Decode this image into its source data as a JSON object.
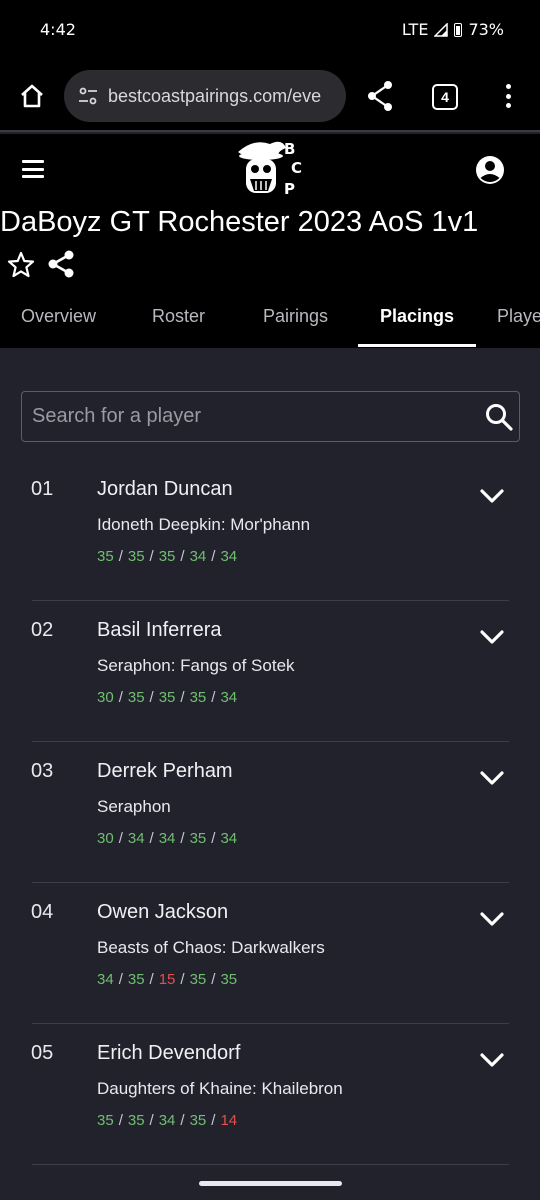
{
  "status": {
    "time": "4:42",
    "network": "LTE",
    "battery": "73%"
  },
  "browser": {
    "url": "bestcoastpairings.com/eve",
    "tab_count": "4"
  },
  "event": {
    "title": "DaBoyz GT Rochester 2023 AoS 1v1"
  },
  "tabs": [
    {
      "label": "Overview",
      "active": false
    },
    {
      "label": "Roster",
      "active": false
    },
    {
      "label": "Pairings",
      "active": false
    },
    {
      "label": "Placings",
      "active": true
    },
    {
      "label": "Playe",
      "active": false
    }
  ],
  "search": {
    "placeholder": "Search for a player",
    "value": ""
  },
  "placings": [
    {
      "rank": "01",
      "name": "Jordan Duncan",
      "faction": "Idoneth Deepkin: Mor'phann",
      "scores": [
        {
          "v": "35",
          "r": "win"
        },
        {
          "v": "35",
          "r": "win"
        },
        {
          "v": "35",
          "r": "win"
        },
        {
          "v": "34",
          "r": "win"
        },
        {
          "v": "34",
          "r": "win"
        }
      ]
    },
    {
      "rank": "02",
      "name": "Basil Inferrera",
      "faction": "Seraphon: Fangs of Sotek",
      "scores": [
        {
          "v": "30",
          "r": "win"
        },
        {
          "v": "35",
          "r": "win"
        },
        {
          "v": "35",
          "r": "win"
        },
        {
          "v": "35",
          "r": "win"
        },
        {
          "v": "34",
          "r": "win"
        }
      ]
    },
    {
      "rank": "03",
      "name": "Derrek Perham",
      "faction": "Seraphon",
      "scores": [
        {
          "v": "30",
          "r": "win"
        },
        {
          "v": "34",
          "r": "win"
        },
        {
          "v": "34",
          "r": "win"
        },
        {
          "v": "35",
          "r": "win"
        },
        {
          "v": "34",
          "r": "win"
        }
      ]
    },
    {
      "rank": "04",
      "name": "Owen Jackson",
      "faction": "Beasts of Chaos: Darkwalkers",
      "scores": [
        {
          "v": "34",
          "r": "win"
        },
        {
          "v": "35",
          "r": "win"
        },
        {
          "v": "15",
          "r": "loss"
        },
        {
          "v": "35",
          "r": "win"
        },
        {
          "v": "35",
          "r": "win"
        }
      ]
    },
    {
      "rank": "05",
      "name": "Erich Devendorf",
      "faction": "Daughters of Khaine: Khailebron",
      "scores": [
        {
          "v": "35",
          "r": "win"
        },
        {
          "v": "35",
          "r": "win"
        },
        {
          "v": "34",
          "r": "win"
        },
        {
          "v": "35",
          "r": "win"
        },
        {
          "v": "14",
          "r": "loss"
        }
      ]
    }
  ],
  "colors": {
    "win": "#6fbf6f",
    "loss": "#e2504a",
    "background": "#22222c",
    "header": "#000000"
  }
}
